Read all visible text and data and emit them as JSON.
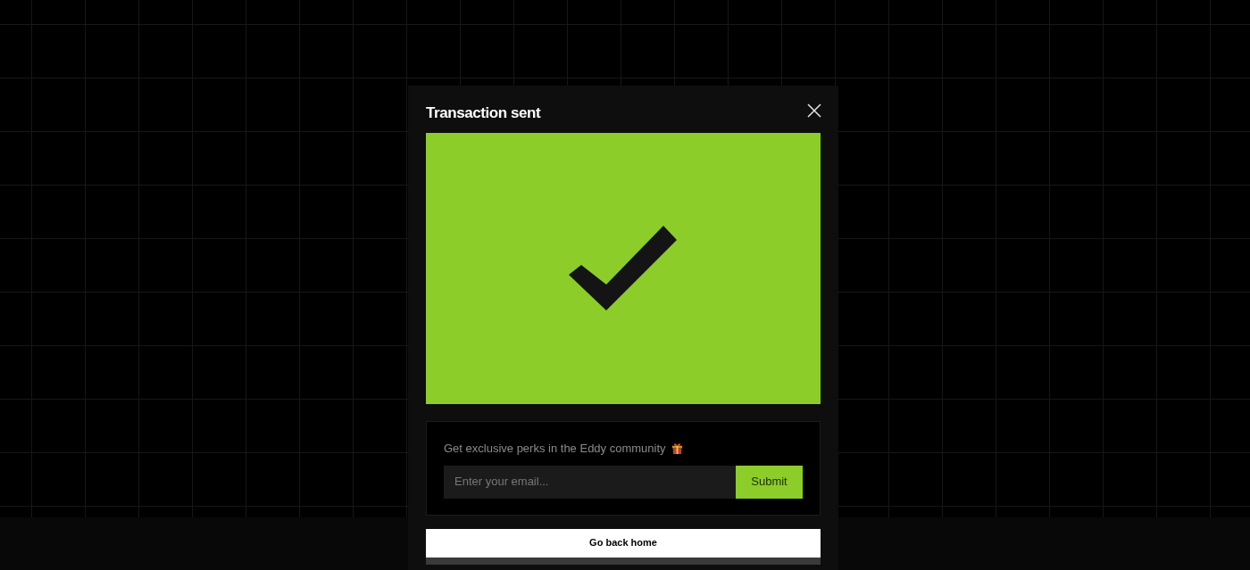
{
  "dialog": {
    "title": "Transaction sent"
  },
  "newsletter": {
    "prompt": "Get exclusive perks in the Eddy community",
    "email": {
      "placeholder": "Enter your email..."
    },
    "submit": "Submit"
  },
  "home_button": "Go back home"
}
